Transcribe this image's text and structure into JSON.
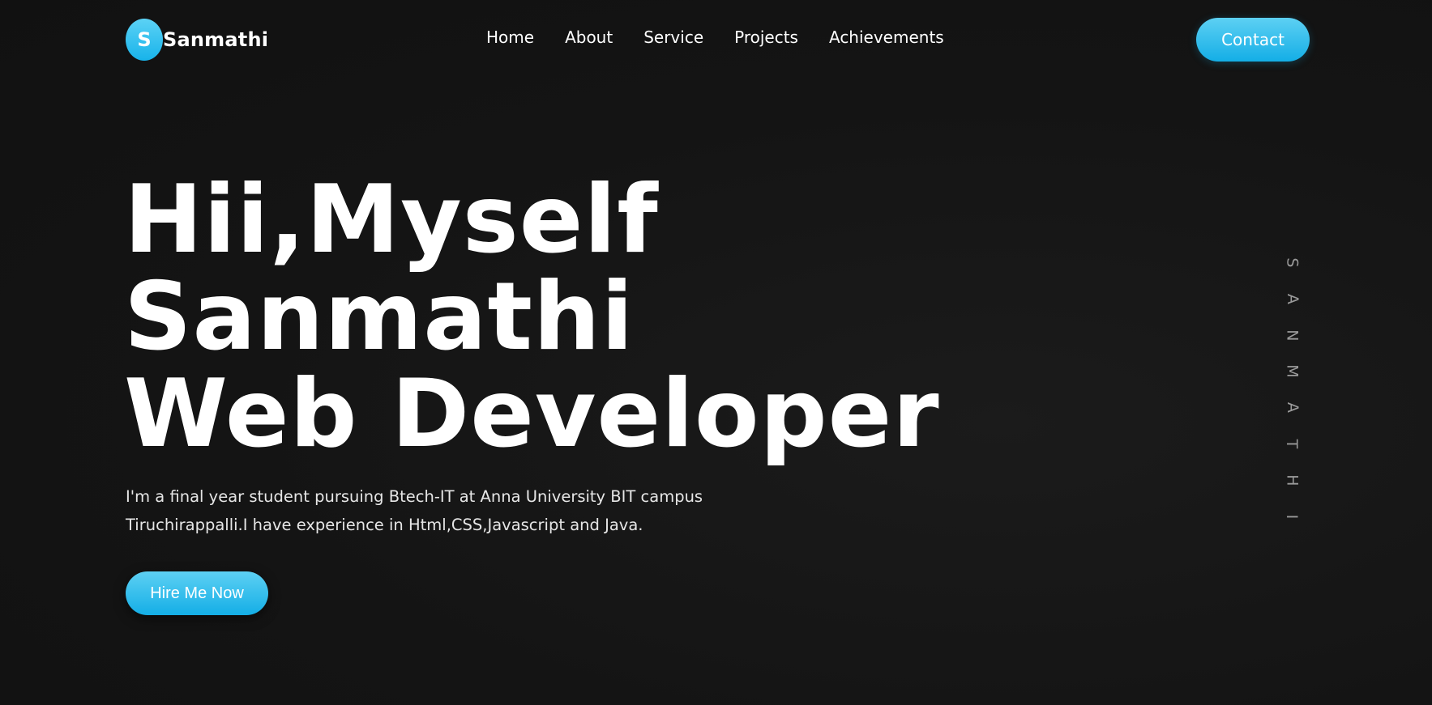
{
  "header": {
    "logo_letter": "S",
    "logo_name": "Sanmathi",
    "nav": [
      {
        "label": "Home"
      },
      {
        "label": "About"
      },
      {
        "label": "Service"
      },
      {
        "label": "Projects"
      },
      {
        "label": "Achievements"
      }
    ],
    "contact_label": "Contact"
  },
  "hero": {
    "title_lines": [
      "Hii,Myself",
      "Sanmathi",
      "Web Developer"
    ],
    "description": "I'm a final year student pursuing Btech-IT at Anna University BIT campus Tiruchirappalli.I have experience in Html,CSS,Javascript and Java.",
    "cta_label": "Hire Me Now"
  },
  "side_name": {
    "letters": [
      "S",
      "A",
      "N",
      "M",
      "A",
      "T",
      "H",
      "I"
    ]
  },
  "colors": {
    "accent": "#14aee6",
    "accent_light": "#5dd0f3",
    "background": "#141414",
    "text": "#ffffff"
  }
}
